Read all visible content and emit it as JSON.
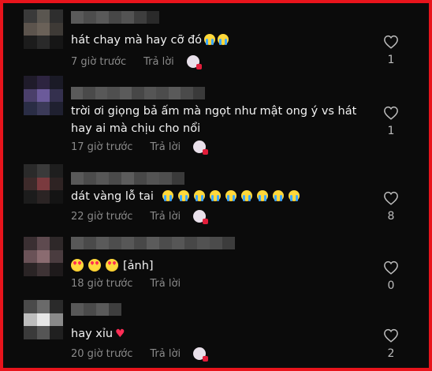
{
  "colors": {
    "frame_border": "#e8141c",
    "background": "#0b0b0b",
    "text": "#f2f2f2",
    "meta": "#8a8a8a"
  },
  "reply_label": "Trả lời",
  "comments": [
    {
      "text": "hát chay mà hay cỡ đó",
      "emojis": [
        "crying-face",
        "crying-face"
      ],
      "time": "7 giờ trước",
      "likes": "1",
      "creator_liked": true
    },
    {
      "text": "trời ơi giọng bả ấm mà ngọt như mật ong ý vs hát hay ai mà chịu cho nổi",
      "emojis": [],
      "time": "17 giờ trước",
      "likes": "1",
      "creator_liked": true
    },
    {
      "text": "dát vàng lỗ tai",
      "emojis": [
        "crying-face",
        "crying-face",
        "crying-face",
        "crying-face",
        "crying-face",
        "crying-face",
        "crying-face",
        "crying-face",
        "crying-face"
      ],
      "time": "22 giờ trước",
      "likes": "8",
      "creator_liked": true
    },
    {
      "text": "[ảnh]",
      "emojis": [
        "heart-eyes-face",
        "heart-eyes-face",
        "heart-eyes-face"
      ],
      "time": "18 giờ trước",
      "likes": "0",
      "creator_liked": false
    },
    {
      "text": "hay xỉu",
      "emojis": [
        "red-heart"
      ],
      "time": "20 giờ trước",
      "likes": "2",
      "creator_liked": true
    }
  ]
}
